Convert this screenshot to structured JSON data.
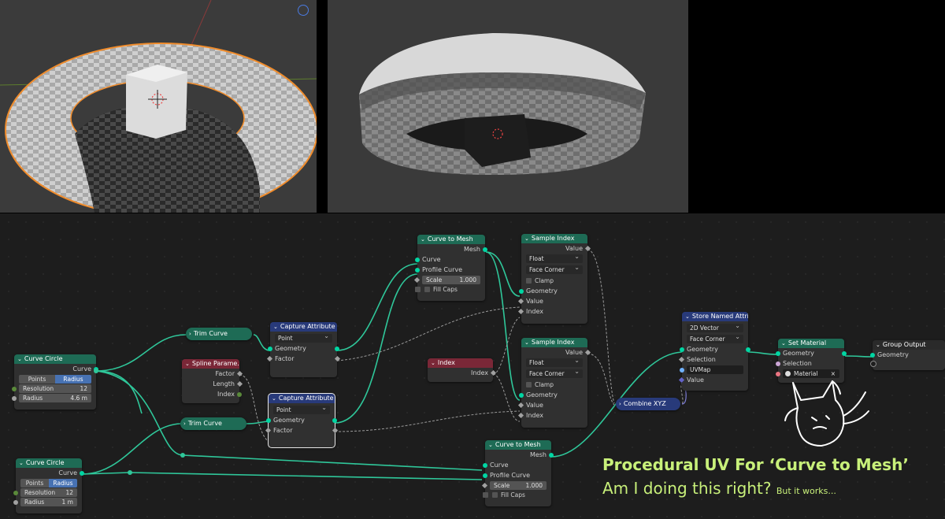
{
  "viewports": {
    "left": {
      "label": "3D viewport - edit view"
    },
    "right": {
      "label": "3D viewport - render view"
    }
  },
  "nodes": {
    "curve_circle_1": {
      "title": "Curve Circle",
      "output": "Curve",
      "mode_a": "Points",
      "mode_b": "Radius",
      "resolution_label": "Resolution",
      "resolution": "12",
      "radius_label": "Radius",
      "radius": "4.6 m"
    },
    "curve_circle_2": {
      "title": "Curve Circle",
      "output": "Curve",
      "mode_a": "Points",
      "mode_b": "Radius",
      "resolution_label": "Resolution",
      "resolution": "12",
      "radius_label": "Radius",
      "radius": "1 m"
    },
    "trim_curve_1": {
      "title": "Trim Curve"
    },
    "trim_curve_2": {
      "title": "Trim Curve"
    },
    "spline_param": {
      "title": "Spline Parame...",
      "out1": "Factor",
      "out2": "Length",
      "out3": "Index"
    },
    "capture_1": {
      "title": "Capture Attribute",
      "domain": "Point",
      "in1": "Geometry",
      "in2": "Factor"
    },
    "capture_2": {
      "title": "Capture Attribute",
      "domain": "Point",
      "in1": "Geometry",
      "in2": "Factor"
    },
    "curve_to_mesh_1": {
      "title": "Curve to Mesh",
      "output": "Mesh",
      "in1": "Curve",
      "in2": "Profile Curve",
      "scale_label": "Scale",
      "scale": "1.000",
      "fill_caps": "Fill Caps"
    },
    "curve_to_mesh_2": {
      "title": "Curve to Mesh",
      "output": "Mesh",
      "in1": "Curve",
      "in2": "Profile Curve",
      "scale_label": "Scale",
      "scale": "1.000",
      "fill_caps": "Fill Caps"
    },
    "sample_index_1": {
      "title": "Sample Index",
      "output": "Value",
      "type": "Float",
      "domain": "Face Corner",
      "clamp": "Clamp",
      "in1": "Geometry",
      "in2": "Value",
      "in3": "Index"
    },
    "sample_index_2": {
      "title": "Sample Index",
      "output": "Value",
      "type": "Float",
      "domain": "Face Corner",
      "clamp": "Clamp",
      "in1": "Geometry",
      "in2": "Value",
      "in3": "Index"
    },
    "index": {
      "title": "Index",
      "output": "Index"
    },
    "combine_xyz": {
      "title": "Combine XYZ"
    },
    "store_named": {
      "title": "Store Named Attri...",
      "type": "2D Vector",
      "domain": "Face Corner",
      "in1": "Geometry",
      "in2": "Selection",
      "name": "UVMap",
      "in3": "Value"
    },
    "set_material": {
      "title": "Set Material",
      "in1": "Geometry",
      "in2": "Selection",
      "material": "Material"
    },
    "group_output": {
      "title": "Group Output",
      "in1": "Geometry"
    }
  },
  "caption": {
    "title": "Procedural UV For ‘Curve to Mesh’",
    "subtitle": "Am I doing this right?",
    "aside": "But it works..."
  },
  "colors": {
    "caption": "#c8f07a",
    "geometry_socket": "#00d6a3",
    "selection": "#e8e8e8"
  }
}
